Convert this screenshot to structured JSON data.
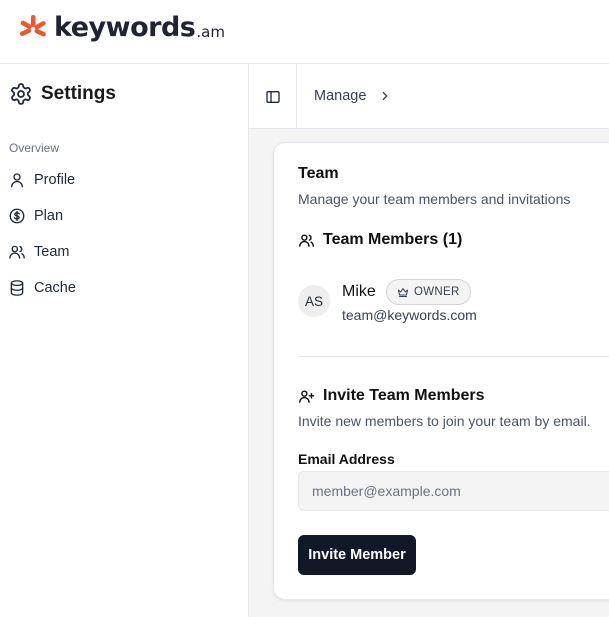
{
  "brand": {
    "name": "keywords",
    "suffix": ".am",
    "accent_color": "#f2552c"
  },
  "sidebar": {
    "title": "Settings",
    "title_icon": "gear-icon",
    "section_label": "Overview",
    "items": [
      {
        "label": "Profile",
        "icon": "user-icon"
      },
      {
        "label": "Plan",
        "icon": "dollar-circle-icon"
      },
      {
        "label": "Team",
        "icon": "users-icon"
      },
      {
        "label": "Cache",
        "icon": "database-icon"
      }
    ]
  },
  "breadcrumb": {
    "toggle_icon": "sidebar-toggle-icon",
    "items": [
      "Manage"
    ]
  },
  "team_card": {
    "title": "Team",
    "subtitle": "Manage your team members and invitations",
    "members_heading": "Team Members (1)",
    "members": [
      {
        "initials": "AS",
        "name": "Mike",
        "role": "OWNER",
        "role_icon": "crown-icon",
        "email": "team@keywords.com"
      }
    ],
    "invite": {
      "heading": "Invite Team Members",
      "description": "Invite new members to join your team by email.",
      "email_label": "Email Address",
      "email_value": "",
      "email_placeholder": "member@example.com",
      "button_label": "Invite Member"
    }
  }
}
